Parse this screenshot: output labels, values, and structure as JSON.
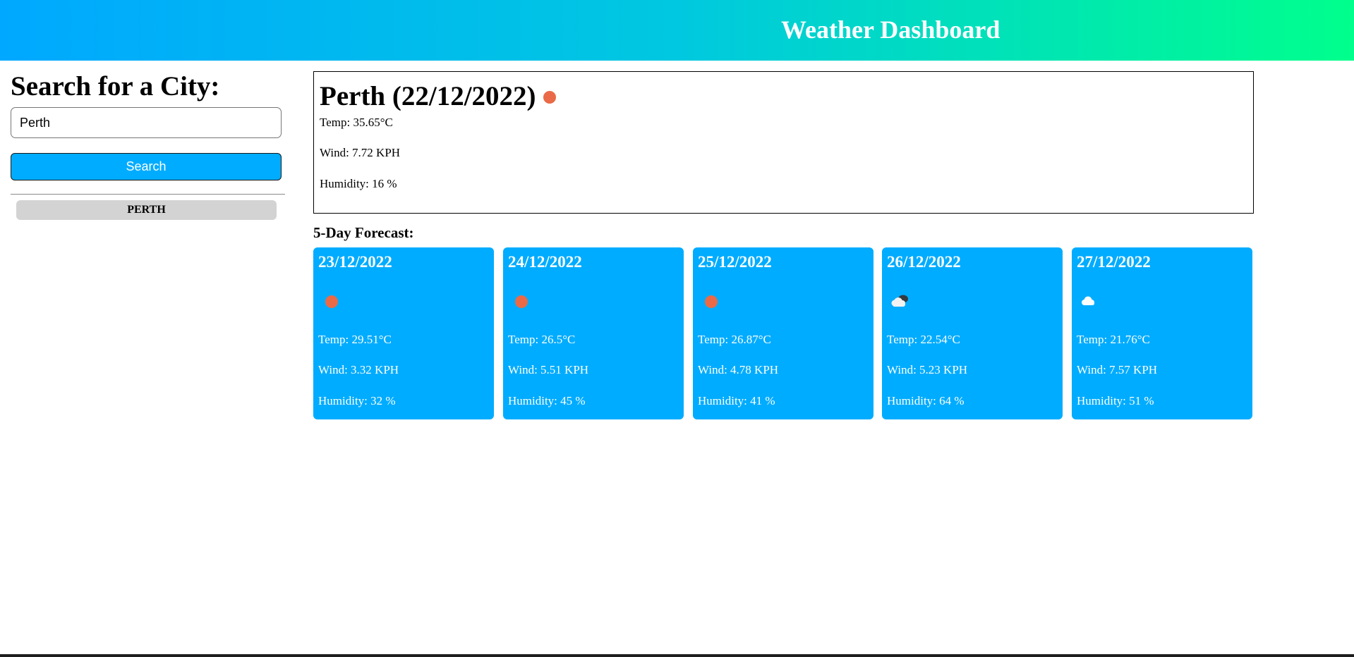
{
  "header": {
    "title": "Weather Dashboard"
  },
  "sidebar": {
    "heading": "Search for a City:",
    "search_value": "Perth",
    "search_button_label": "Search",
    "history": [
      {
        "label": "PERTH"
      }
    ]
  },
  "current": {
    "title": "Perth (22/12/2022)",
    "icon": "sun-icon",
    "temp": "Temp: 35.65°C",
    "wind": "Wind: 7.72 KPH",
    "humidity": "Humidity: 16 %"
  },
  "forecast": {
    "heading": "5-Day Forecast:",
    "days": [
      {
        "date": "23/12/2022",
        "icon": "sun-icon",
        "temp": "Temp: 29.51°C",
        "wind": "Wind: 3.32 KPH",
        "humidity": "Humidity: 32 %"
      },
      {
        "date": "24/12/2022",
        "icon": "sun-icon",
        "temp": "Temp: 26.5°C",
        "wind": "Wind: 5.51 KPH",
        "humidity": "Humidity: 45 %"
      },
      {
        "date": "25/12/2022",
        "icon": "sun-icon",
        "temp": "Temp: 26.87°C",
        "wind": "Wind: 4.78 KPH",
        "humidity": "Humidity: 41 %"
      },
      {
        "date": "26/12/2022",
        "icon": "broken-clouds-icon",
        "temp": "Temp: 22.54°C",
        "wind": "Wind: 5.23 KPH",
        "humidity": "Humidity: 64 %"
      },
      {
        "date": "27/12/2022",
        "icon": "cloud-icon",
        "temp": "Temp: 21.76°C",
        "wind": "Wind: 7.57 KPH",
        "humidity": "Humidity: 51 %"
      }
    ]
  },
  "colors": {
    "card_background": "#00acff",
    "sun": "#ea6a47",
    "history_button": "#d3d3d3"
  }
}
